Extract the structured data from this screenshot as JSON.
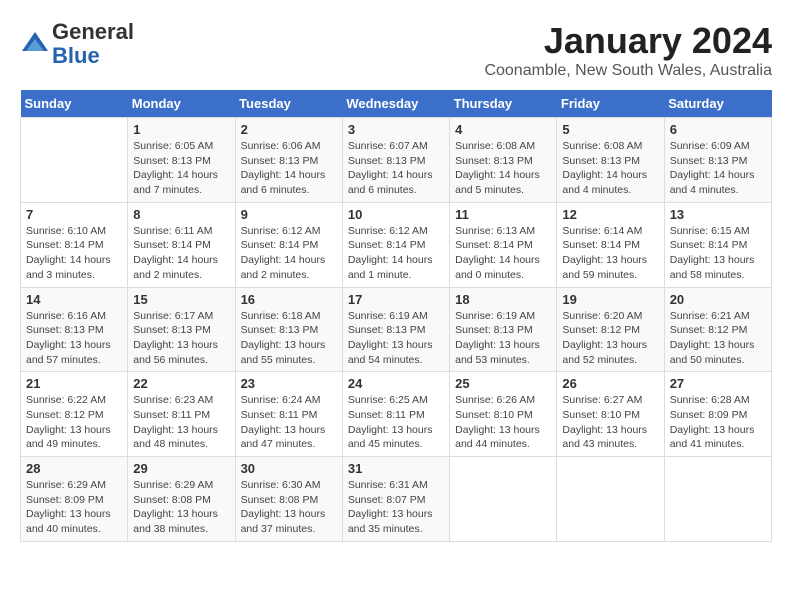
{
  "logo": {
    "general": "General",
    "blue": "Blue"
  },
  "header": {
    "month": "January 2024",
    "location": "Coonamble, New South Wales, Australia"
  },
  "days_of_week": [
    "Sunday",
    "Monday",
    "Tuesday",
    "Wednesday",
    "Thursday",
    "Friday",
    "Saturday"
  ],
  "weeks": [
    [
      {
        "day": "",
        "info": ""
      },
      {
        "day": "1",
        "info": "Sunrise: 6:05 AM\nSunset: 8:13 PM\nDaylight: 14 hours\nand 7 minutes."
      },
      {
        "day": "2",
        "info": "Sunrise: 6:06 AM\nSunset: 8:13 PM\nDaylight: 14 hours\nand 6 minutes."
      },
      {
        "day": "3",
        "info": "Sunrise: 6:07 AM\nSunset: 8:13 PM\nDaylight: 14 hours\nand 6 minutes."
      },
      {
        "day": "4",
        "info": "Sunrise: 6:08 AM\nSunset: 8:13 PM\nDaylight: 14 hours\nand 5 minutes."
      },
      {
        "day": "5",
        "info": "Sunrise: 6:08 AM\nSunset: 8:13 PM\nDaylight: 14 hours\nand 4 minutes."
      },
      {
        "day": "6",
        "info": "Sunrise: 6:09 AM\nSunset: 8:13 PM\nDaylight: 14 hours\nand 4 minutes."
      }
    ],
    [
      {
        "day": "7",
        "info": "Sunrise: 6:10 AM\nSunset: 8:14 PM\nDaylight: 14 hours\nand 3 minutes."
      },
      {
        "day": "8",
        "info": "Sunrise: 6:11 AM\nSunset: 8:14 PM\nDaylight: 14 hours\nand 2 minutes."
      },
      {
        "day": "9",
        "info": "Sunrise: 6:12 AM\nSunset: 8:14 PM\nDaylight: 14 hours\nand 2 minutes."
      },
      {
        "day": "10",
        "info": "Sunrise: 6:12 AM\nSunset: 8:14 PM\nDaylight: 14 hours\nand 1 minute."
      },
      {
        "day": "11",
        "info": "Sunrise: 6:13 AM\nSunset: 8:14 PM\nDaylight: 14 hours\nand 0 minutes."
      },
      {
        "day": "12",
        "info": "Sunrise: 6:14 AM\nSunset: 8:14 PM\nDaylight: 13 hours\nand 59 minutes."
      },
      {
        "day": "13",
        "info": "Sunrise: 6:15 AM\nSunset: 8:14 PM\nDaylight: 13 hours\nand 58 minutes."
      }
    ],
    [
      {
        "day": "14",
        "info": "Sunrise: 6:16 AM\nSunset: 8:13 PM\nDaylight: 13 hours\nand 57 minutes."
      },
      {
        "day": "15",
        "info": "Sunrise: 6:17 AM\nSunset: 8:13 PM\nDaylight: 13 hours\nand 56 minutes."
      },
      {
        "day": "16",
        "info": "Sunrise: 6:18 AM\nSunset: 8:13 PM\nDaylight: 13 hours\nand 55 minutes."
      },
      {
        "day": "17",
        "info": "Sunrise: 6:19 AM\nSunset: 8:13 PM\nDaylight: 13 hours\nand 54 minutes."
      },
      {
        "day": "18",
        "info": "Sunrise: 6:19 AM\nSunset: 8:13 PM\nDaylight: 13 hours\nand 53 minutes."
      },
      {
        "day": "19",
        "info": "Sunrise: 6:20 AM\nSunset: 8:12 PM\nDaylight: 13 hours\nand 52 minutes."
      },
      {
        "day": "20",
        "info": "Sunrise: 6:21 AM\nSunset: 8:12 PM\nDaylight: 13 hours\nand 50 minutes."
      }
    ],
    [
      {
        "day": "21",
        "info": "Sunrise: 6:22 AM\nSunset: 8:12 PM\nDaylight: 13 hours\nand 49 minutes."
      },
      {
        "day": "22",
        "info": "Sunrise: 6:23 AM\nSunset: 8:11 PM\nDaylight: 13 hours\nand 48 minutes."
      },
      {
        "day": "23",
        "info": "Sunrise: 6:24 AM\nSunset: 8:11 PM\nDaylight: 13 hours\nand 47 minutes."
      },
      {
        "day": "24",
        "info": "Sunrise: 6:25 AM\nSunset: 8:11 PM\nDaylight: 13 hours\nand 45 minutes."
      },
      {
        "day": "25",
        "info": "Sunrise: 6:26 AM\nSunset: 8:10 PM\nDaylight: 13 hours\nand 44 minutes."
      },
      {
        "day": "26",
        "info": "Sunrise: 6:27 AM\nSunset: 8:10 PM\nDaylight: 13 hours\nand 43 minutes."
      },
      {
        "day": "27",
        "info": "Sunrise: 6:28 AM\nSunset: 8:09 PM\nDaylight: 13 hours\nand 41 minutes."
      }
    ],
    [
      {
        "day": "28",
        "info": "Sunrise: 6:29 AM\nSunset: 8:09 PM\nDaylight: 13 hours\nand 40 minutes."
      },
      {
        "day": "29",
        "info": "Sunrise: 6:29 AM\nSunset: 8:08 PM\nDaylight: 13 hours\nand 38 minutes."
      },
      {
        "day": "30",
        "info": "Sunrise: 6:30 AM\nSunset: 8:08 PM\nDaylight: 13 hours\nand 37 minutes."
      },
      {
        "day": "31",
        "info": "Sunrise: 6:31 AM\nSunset: 8:07 PM\nDaylight: 13 hours\nand 35 minutes."
      },
      {
        "day": "",
        "info": ""
      },
      {
        "day": "",
        "info": ""
      },
      {
        "day": "",
        "info": ""
      }
    ]
  ]
}
